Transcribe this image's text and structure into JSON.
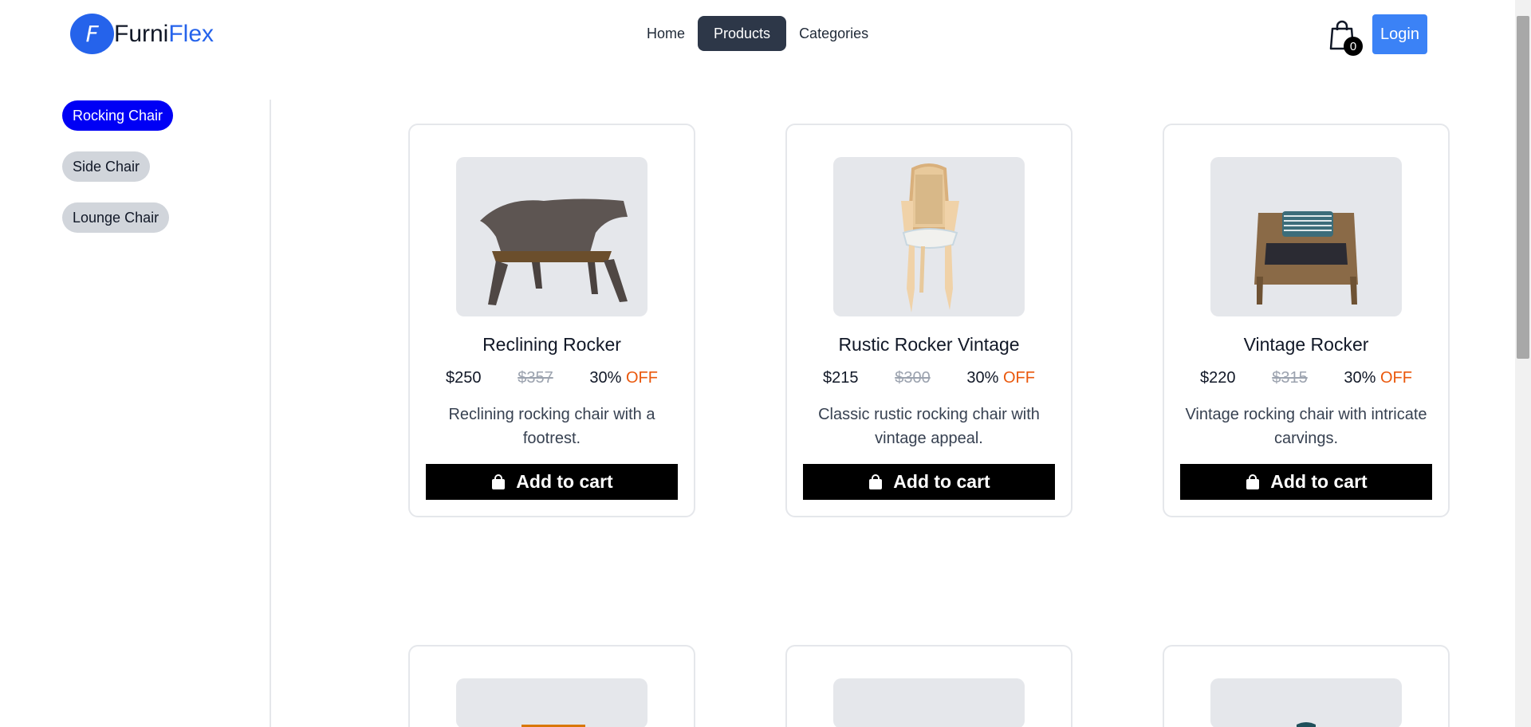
{
  "brand": {
    "initial": "F",
    "name_part1": "Furni",
    "name_part2": "Flex"
  },
  "nav": {
    "items": [
      {
        "label": "Home"
      },
      {
        "label": "Products"
      },
      {
        "label": "Categories"
      }
    ]
  },
  "cart": {
    "count": "0"
  },
  "auth": {
    "login_label": "Login"
  },
  "categories": [
    {
      "label": "Rocking Chair"
    },
    {
      "label": "Side Chair"
    },
    {
      "label": "Lounge Chair"
    }
  ],
  "products": [
    {
      "name": "Reclining Rocker",
      "price": "$250",
      "old_price": "$357",
      "discount": "30%",
      "off": "OFF",
      "description": "Reclining rocking chair with a footrest.",
      "button": "Add to cart"
    },
    {
      "name": "Rustic Rocker Vintage",
      "price": "$215",
      "old_price": "$300",
      "discount": "30%",
      "off": "OFF",
      "description": "Classic rustic rocking chair with vintage appeal.",
      "button": "Add to cart"
    },
    {
      "name": "Vintage Rocker",
      "price": "$220",
      "old_price": "$315",
      "discount": "30%",
      "off": "OFF",
      "description": "Vintage rocking chair with intricate carvings.",
      "button": "Add to cart"
    }
  ],
  "colors": {
    "accent": "#2563eb",
    "active_nav": "#2d3748",
    "active_chip": "#0000f5",
    "login": "#3b82f6",
    "off": "#ea580c"
  }
}
